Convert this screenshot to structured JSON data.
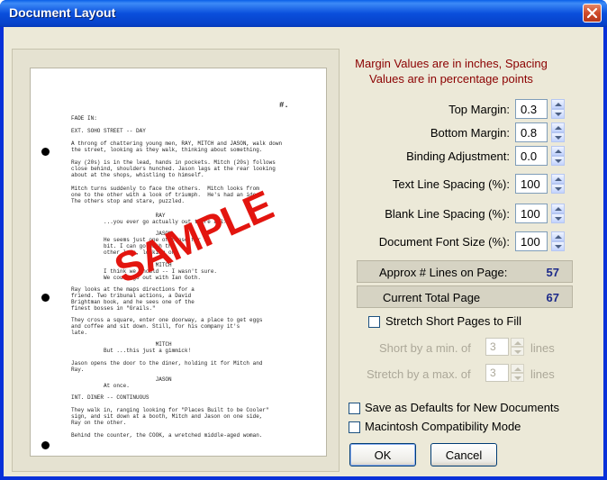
{
  "window": {
    "title": "Document Layout"
  },
  "preview": {
    "page_number": "#.",
    "text_blocks": [
      "FADE IN:",
      "EXT. SOHO STREET -- DAY",
      "A throng of chattering young men, RAY, MITCH and JASON, walk down\nthe street, looking as they walk, thinking about something.",
      "Ray (20s) is in the lead, hands in pockets. Mitch (20s) follows\nclose behind, shoulders hunched. Jason lags at the rear looking\nabout at the shops, whistling to himself.",
      "Mitch turns suddenly to face the others.  Mitch looks from\none to the other with a look of triumph.  He's had an idea.\nThe others stop and stare, puzzled.",
      "                          RAY\n          ...you ever go actually out there all?",
      "                          JASON\n          He seems just one of those for a\n          bit. I can go with the\n          other lads, looking on.",
      "                          MITCH\n          I think we should -- I wasn't sure.\n          We could go out with Ian Goth.",
      "Ray looks at the maps directions for a\nfriend. Two tribunal actions, a David\nBrightman book, and he sees one of the\nfinest bosses in \"Grails.\"",
      "They cross a square, enter one doorway, a place to get eggs\nand coffee and sit down. Still, for his company it's\nlate.",
      "                          MITCH\n          But ...this just a gimmick!",
      "Jason opens the door to the diner, holding it for Mitch and\nRay.",
      "                          JASON\n          At once.",
      "INT. DINER -- CONTINUOUS",
      "They walk in, ranging looking for \"Places Built to be Cooler\"\nsign, and sit down at a booth, Mitch and Jason on one side,\nRay on the other.",
      "Behind the counter, the COOK, a wretched middle-aged woman."
    ],
    "watermark": "SAMPLE"
  },
  "hint": "Margin Values are in inches, Spacing Values are in percentage points",
  "fields": {
    "top_margin": {
      "label": "Top Margin:",
      "value": "0.3"
    },
    "bottom_margin": {
      "label": "Bottom Margin:",
      "value": "0.8"
    },
    "binding": {
      "label": "Binding Adjustment:",
      "value": "0.0"
    },
    "text_spacing": {
      "label": "Text Line Spacing (%):",
      "value": "100"
    },
    "blank_spacing": {
      "label": "Blank Line Spacing (%):",
      "value": "100"
    },
    "font_size": {
      "label": "Document Font Size (%):",
      "value": "100"
    }
  },
  "info": {
    "lines_label": "Approx # Lines on Page:",
    "lines_value": "57",
    "total_label": "Current Total Page",
    "total_value": "67"
  },
  "stretch": {
    "checkbox_label": "Stretch Short Pages to Fill",
    "short_label": "Short by a min. of",
    "short_value": "3",
    "short_unit": "lines",
    "stretch_label": "Stretch by a max. of",
    "stretch_value": "3",
    "stretch_unit": "lines"
  },
  "options": {
    "defaults_label": "Save as Defaults for New Documents",
    "mac_label": "Macintosh Compatibility Mode"
  },
  "buttons": {
    "ok": "OK",
    "cancel": "Cancel"
  }
}
